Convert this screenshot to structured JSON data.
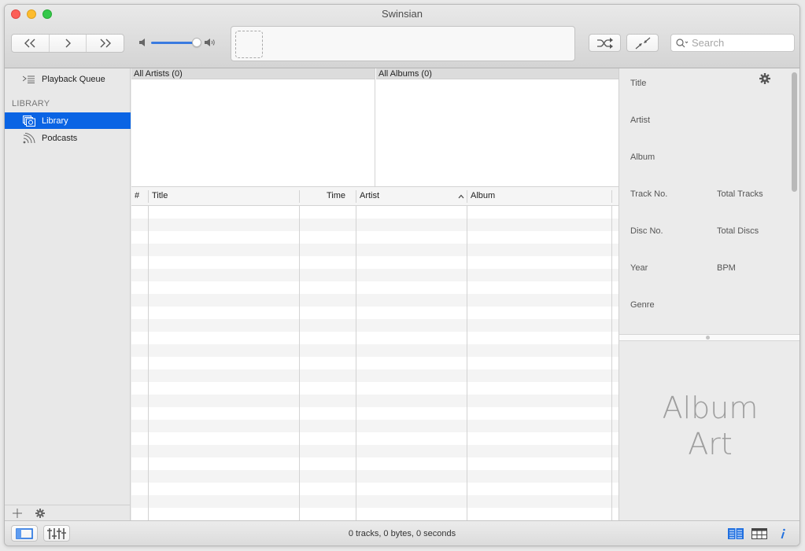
{
  "window": {
    "title": "Swinsian"
  },
  "toolbar": {
    "transport": [
      {
        "name": "previous",
        "glyph": "«"
      },
      {
        "name": "play",
        "glyph": "›"
      },
      {
        "name": "next",
        "glyph": "»"
      }
    ],
    "volume": 0.85,
    "search_placeholder": "Search",
    "search_value": ""
  },
  "sidebar": {
    "playback_queue": "Playback Queue",
    "section_header": "LIBRARY",
    "items": [
      {
        "label": "Library",
        "icon": "library-icon",
        "selected": true
      },
      {
        "label": "Podcasts",
        "icon": "podcast-icon",
        "selected": false
      }
    ]
  },
  "browser": {
    "artists_header": "All Artists (0)",
    "albums_header": "All Albums (0)"
  },
  "tracks": {
    "columns": [
      {
        "label": "#"
      },
      {
        "label": "Title"
      },
      {
        "label": "Time"
      },
      {
        "label": "Artist",
        "sorted": "ascending"
      },
      {
        "label": "Album"
      }
    ],
    "rows": []
  },
  "inspector": {
    "fields": {
      "title": "Title",
      "artist": "Artist",
      "album": "Album",
      "track_no": "Track No.",
      "total_tracks": "Total Tracks",
      "disc_no": "Disc No.",
      "total_discs": "Total Discs",
      "year": "Year",
      "bpm": "BPM",
      "genre": "Genre"
    },
    "album_art_line1": "Album",
    "album_art_line2": "Art"
  },
  "status": {
    "text": "0 tracks,  0 bytes,  0 seconds"
  },
  "colors": {
    "accent": "#0a64e4",
    "volume_fill": "#3a7be0"
  }
}
